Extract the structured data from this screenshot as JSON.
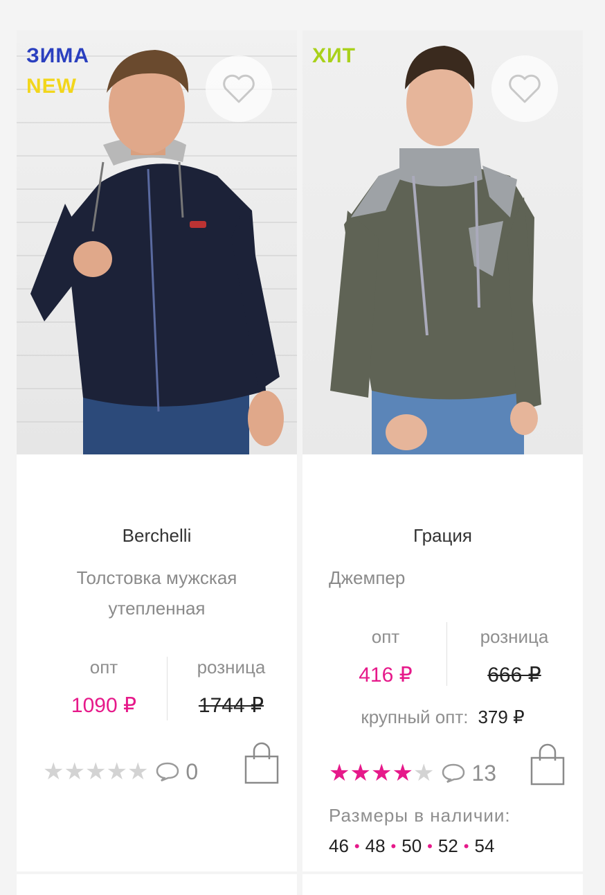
{
  "products": [
    {
      "badges": [
        "ЗИМА",
        "NEW"
      ],
      "brand": "Berchelli",
      "name_line1": "Толстовка мужская",
      "name_line2": "утепленная",
      "opt_label": "опт",
      "retail_label": "розница",
      "opt_price": "1090 ₽",
      "retail_price": "1744 ₽",
      "rating": 0,
      "comments": "0"
    },
    {
      "badges": [
        "ХИТ"
      ],
      "brand": "Грация",
      "name_line1": "Джемпер",
      "opt_label": "опт",
      "retail_label": "розница",
      "opt_price": "416 ₽",
      "retail_price": "666 ₽",
      "bulk_label": "крупный опт:",
      "bulk_price": "379 ₽",
      "rating": 4,
      "comments": "13",
      "sizes_title": "Размеры в наличии:",
      "sizes": [
        "46",
        "48",
        "50",
        "52",
        "54"
      ]
    }
  ],
  "colors": {
    "accent": "#e6198a",
    "badge_blue": "#2a3fbf",
    "badge_yellow": "#f2d61c",
    "badge_green": "#a9d11a"
  },
  "icons": [
    "heart-icon",
    "star-icon",
    "comment-icon",
    "shopping-bag-icon"
  ]
}
